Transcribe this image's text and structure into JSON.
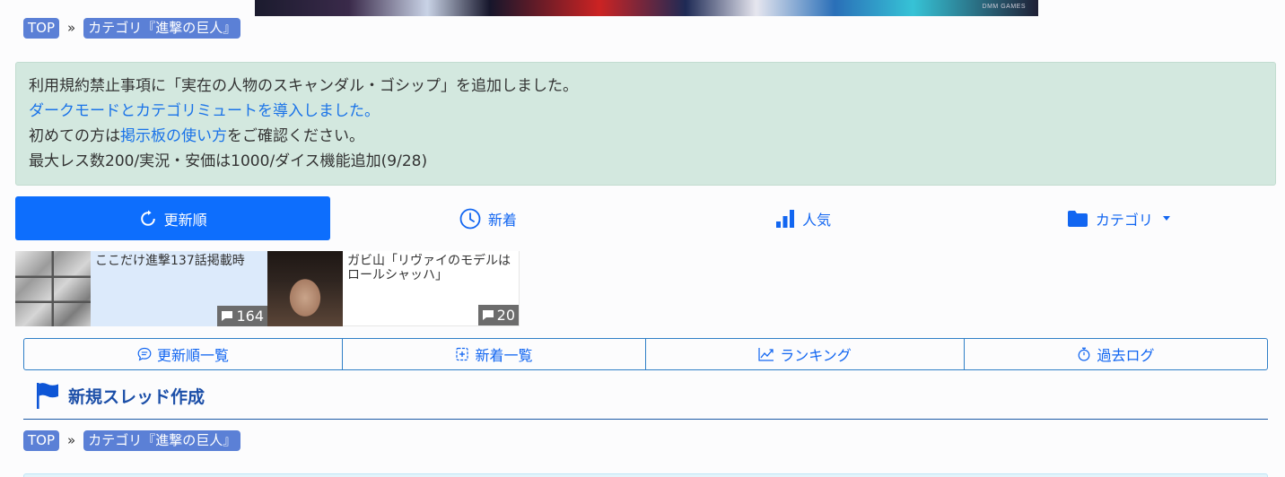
{
  "banner": {
    "brand": "DMM GAMES"
  },
  "breadcrumb": {
    "top": "TOP",
    "sep": "»",
    "category": "カテゴリ『進撃の巨人』"
  },
  "notice": {
    "line1": "利用規約禁止事項に「実在の人物のスキャンダル・ゴシップ」を追加しました。",
    "line2_link": "ダークモードとカテゴリミュートを導入しました。",
    "line3_pre": "初めての方は",
    "line3_link": "掲示板の使い方",
    "line3_post": "をご確認ください。",
    "line4": "最大レス数200/実況・安価は1000/ダイス機能追加(9/28)"
  },
  "tabs": [
    {
      "label": "更新順",
      "icon": "refresh-icon",
      "active": true
    },
    {
      "label": "新着",
      "icon": "clock-icon",
      "active": false
    },
    {
      "label": "人気",
      "icon": "bar-chart-icon",
      "active": false
    },
    {
      "label": "カテゴリ",
      "icon": "folder-icon",
      "active": false
    }
  ],
  "threads": [
    {
      "title": "ここだけ進撃137話掲載時",
      "count": "164"
    },
    {
      "title": "ガビ山「リヴァイのモデルはロールシャッハ」",
      "count": "20"
    }
  ],
  "subnav": [
    {
      "label": "更新順一覧",
      "icon": "chat-icon"
    },
    {
      "label": "新着一覧",
      "icon": "plus-square-icon"
    },
    {
      "label": "ランキング",
      "icon": "graph-up-icon"
    },
    {
      "label": "過去ログ",
      "icon": "stopwatch-icon"
    }
  ],
  "new_thread": {
    "label": "新規スレッド作成",
    "icon": "flag-icon"
  },
  "colors": {
    "primary": "#0d6efd",
    "notice_bg": "#d3e8df",
    "crumb_bg": "#5b80d6"
  }
}
